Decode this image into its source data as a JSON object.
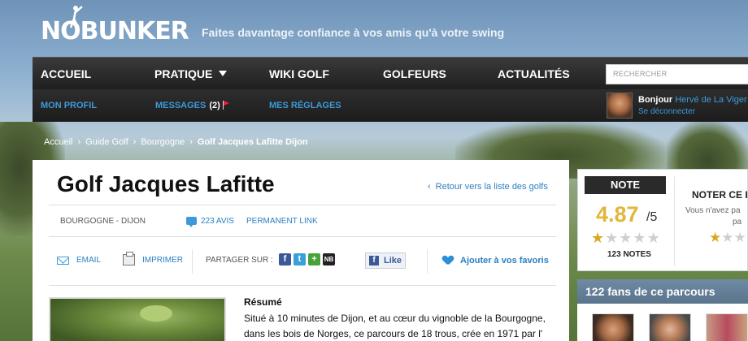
{
  "header": {
    "logo": "NOBUNKER",
    "tagline": "Faites davantage confiance à vos amis qu'à votre swing"
  },
  "nav": {
    "items": [
      "ACCUEIL",
      "PRATIQUE",
      "WIKI GOLF",
      "GOLFEURS",
      "ACTUALITÉS"
    ],
    "search_placeholder": "RECHERCHER"
  },
  "subnav": {
    "profil": "MON PROFIL",
    "messages": "MESSAGES",
    "messages_count": "(2)",
    "reglages": "MES RÉGLAGES",
    "greeting": "Bonjour",
    "user_name": "Hervé de La Viger",
    "logout": "Se déconnecter"
  },
  "breadcrumb": [
    "Accueil",
    "Guide Golf",
    "Bourgogne",
    "Golf Jacques Lafitte Dijon"
  ],
  "page": {
    "title": "Golf Jacques Lafitte",
    "back_link": "Retour vers la liste des golfs",
    "region": "BOURGOGNE - DIJON",
    "avis": "223 AVIS",
    "permalink": "PERMANENT LINK"
  },
  "actions": {
    "email": "EMAIL",
    "print": "IMPRIMER",
    "share_label": "PARTAGER SUR :",
    "like": "Like",
    "favorite": "Ajouter à vos favoris"
  },
  "resume": {
    "title": "Résumé",
    "text": "Situé à 10 minutes de Dijon, et au cœur du vignoble de la Bourgogne, dans les bois de Norges, ce parcours de 18 trous, crée en 1971 par l'"
  },
  "rating": {
    "label": "NOTE",
    "value": "4.87",
    "max": "/5",
    "count": "123 NOTES",
    "stars_filled": 1,
    "noter_title": "NOTER CE I",
    "noter_text1": "Vous n'avez pa",
    "noter_text2": "pa"
  },
  "fans": {
    "title": "122 fans de ce parcours"
  },
  "colors": {
    "accent": "#3d9ad8",
    "rating": "#e2b63a",
    "nav_bg": "#2a2a2a"
  }
}
